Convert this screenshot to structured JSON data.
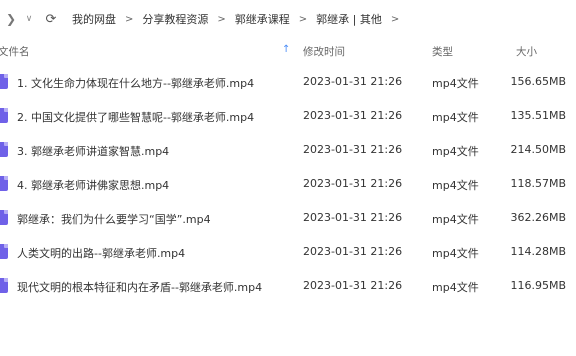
{
  "toolbar": {
    "forward_icon": "chevron-right-icon",
    "dropdown_icon": "chevron-down-icon",
    "refresh_icon": "refresh-icon",
    "breadcrumbs": [
      "我的网盘",
      "分享教程资源",
      "郭继承课程",
      "郭继承 | 其他"
    ],
    "separator": ">"
  },
  "columns": {
    "name": "文件名",
    "modified": "修改时间",
    "type": "类型",
    "size": "大小",
    "sort_icon": "arrow-up-icon"
  },
  "files": [
    {
      "name": "1. 文化生命力体现在什么地方--郭继承老师.mp4",
      "modified": "2023-01-31 21:26",
      "type": "mp4文件",
      "size": "156.65MB"
    },
    {
      "name": "2. 中国文化提供了哪些智慧呢--郭继承老师.mp4",
      "modified": "2023-01-31 21:26",
      "type": "mp4文件",
      "size": "135.51MB"
    },
    {
      "name": "3. 郭继承老师讲道家智慧.mp4",
      "modified": "2023-01-31 21:26",
      "type": "mp4文件",
      "size": "214.50MB"
    },
    {
      "name": "4. 郭继承老师讲佛家思想.mp4",
      "modified": "2023-01-31 21:26",
      "type": "mp4文件",
      "size": "118.57MB"
    },
    {
      "name": "郭继承：我们为什么要学习“国学”.mp4",
      "modified": "2023-01-31 21:26",
      "type": "mp4文件",
      "size": "362.26MB"
    },
    {
      "name": "人类文明的出路--郭继承老师.mp4",
      "modified": "2023-01-31 21:26",
      "type": "mp4文件",
      "size": "114.28MB"
    },
    {
      "name": "现代文明的根本特征和内在矛盾--郭继承老师.mp4",
      "modified": "2023-01-31 21:26",
      "type": "mp4文件",
      "size": "116.95MB"
    }
  ],
  "colors": {
    "file_icon": "#6f61e8",
    "sort_arrow": "#4a8cf7"
  }
}
